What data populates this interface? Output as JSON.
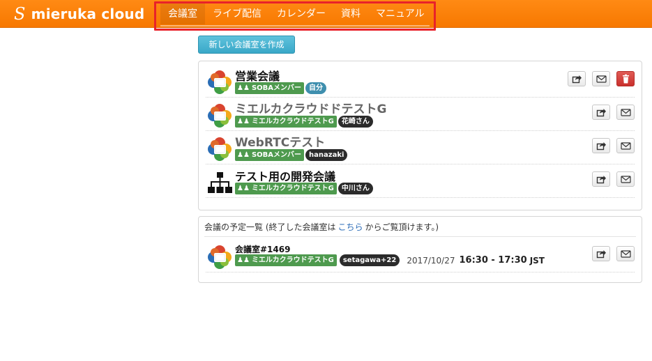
{
  "app": {
    "logo": "S",
    "brand": "mieruka cloud"
  },
  "nav": {
    "items": [
      "会議室",
      "ライブ配信",
      "カレンダー",
      "資料",
      "マニュアル"
    ],
    "active": "会議室"
  },
  "actions": {
    "create_room": "新しい会議室を作成"
  },
  "rooms": [
    {
      "title": "営業会議",
      "group": "SOBAメンバー",
      "owner": "自分",
      "owner_is_self": true,
      "icon": "webrtc-logo-icon",
      "can_delete": true
    },
    {
      "title": "ミエルカクラウドドテストG",
      "group": "ミエルカクラウドテストG",
      "owner": "花崎さん",
      "owner_is_self": false,
      "icon": "webrtc-logo-icon",
      "can_delete": false
    },
    {
      "title": "WebRTCテスト",
      "group": "SOBAメンバー",
      "owner": "hanazaki",
      "owner_is_self": false,
      "icon": "webrtc-logo-icon",
      "can_delete": false
    },
    {
      "title": "テスト用の開発会議",
      "group": "ミエルカクラウドテストG",
      "owner": "中川さん",
      "owner_is_self": false,
      "icon": "org-chart-icon",
      "can_delete": false
    }
  ],
  "schedule": {
    "header_prefix": "会議の予定一覧 (終了した会議室は",
    "header_link": "こちら",
    "header_suffix": "からご覧頂けます。)",
    "items": [
      {
        "title": "会議室#1469",
        "group": "ミエルカクラウドテストG",
        "owner": "setagawa+22",
        "date": "2017/10/27",
        "time": "16:30 - 17:30",
        "tz": "JST"
      }
    ]
  },
  "colors": {
    "navbar": "#f77800",
    "highlight_box": "#e8222a",
    "create_button": "#3aa8c8",
    "group_tag": "#4e9a4e",
    "owner_tag": "#2b2b2b",
    "self_tag": "#3f8fae",
    "delete_button": "#c9302c"
  }
}
